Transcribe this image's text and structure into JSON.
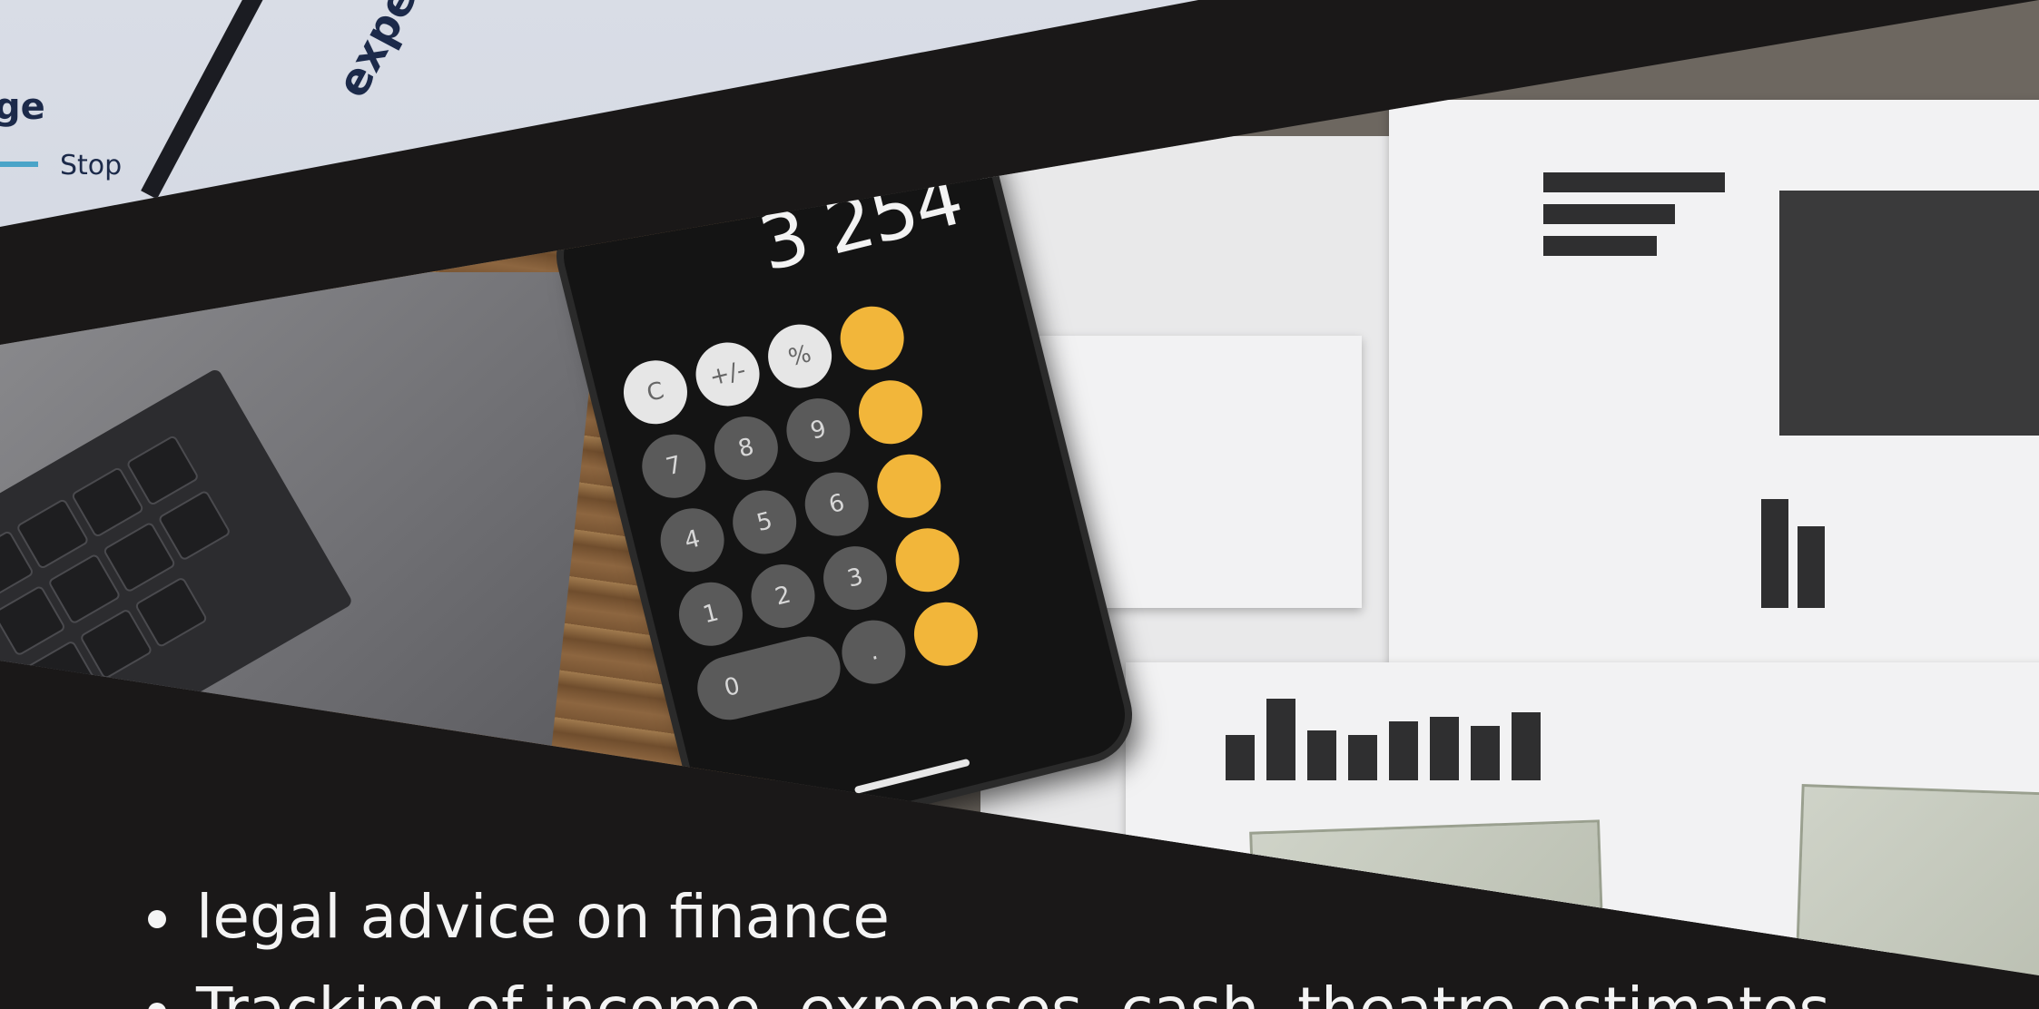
{
  "top_sliver": {
    "stop_label": "Stop",
    "partial_word_1": "ge",
    "partial_word_2": "expec"
  },
  "phone": {
    "display_value": "3 254",
    "buttons_row1": [
      "C",
      "+/-",
      "%"
    ],
    "digits": [
      [
        "7",
        "8",
        "9"
      ],
      [
        "4",
        "5",
        "6"
      ],
      [
        "1",
        "2",
        "3"
      ]
    ],
    "zero": "0",
    "dot": ".",
    "accent_color": "#f2b63a"
  },
  "bullets": [
    "legal advice on finance",
    "Tracking of income, expenses, cash, theatre estimates"
  ],
  "colors": {
    "background": "#1a1818",
    "text": "#f4f4f4"
  }
}
